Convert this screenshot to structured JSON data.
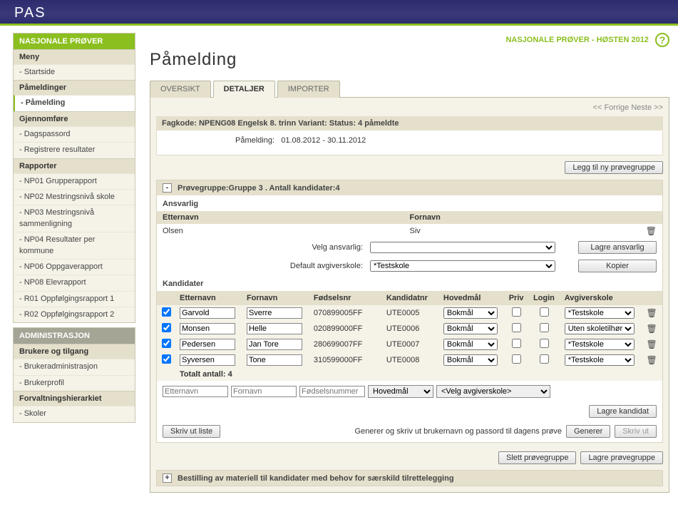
{
  "app": {
    "title": "PAS"
  },
  "context": {
    "label": "NASJONALE PRØVER - HØSTEN 2012",
    "help": "?"
  },
  "page": {
    "title": "Påmelding"
  },
  "sidebar": {
    "sections": [
      {
        "header": "NASJONALE PRØVER",
        "groups": [
          {
            "title": "Meny",
            "items": [
              "- Startside"
            ]
          },
          {
            "title": "Påmeldinger",
            "items": [
              "- Påmelding"
            ],
            "activeItem": "- Påmelding"
          },
          {
            "title": "Gjennomføre",
            "items": [
              "- Dagspassord",
              "- Registrere resultater"
            ]
          },
          {
            "title": "Rapporter",
            "items": [
              "- NP01 Grupperapport",
              "- NP02 Mestringsnivå skole",
              "- NP03 Mestringsnivå sammenligning",
              "- NP04 Resultater per kommune",
              "- NP06 Oppgaverapport",
              "- NP08 Elevrapport",
              "- R01 Oppfølgingsrapport 1",
              "- R02 Oppfølgingsrapport 2"
            ]
          }
        ]
      },
      {
        "header": "ADMINISTRASJON",
        "headerClass": "grey",
        "groups": [
          {
            "title": "Brukere og tilgang",
            "items": [
              "- Brukeradministrasjon",
              "- Brukerprofil"
            ]
          },
          {
            "title": "Forvaltningshierarkiet",
            "items": [
              "- Skoler"
            ]
          }
        ]
      }
    ]
  },
  "tabs": [
    {
      "label": "OVERSIKT",
      "active": false
    },
    {
      "label": "DETALJER",
      "active": true
    },
    {
      "label": "IMPORTER",
      "active": false
    }
  ],
  "pager": {
    "prev": "<< Forrige",
    "next": "Neste >>"
  },
  "infobar": "Fagkode: NPENG08 Engelsk 8. trinn Variant: Status: 4 påmeldte",
  "infobody": {
    "label": "Påmelding:",
    "value": "01.08.2012 - 30.11.2012"
  },
  "buttons": {
    "addGroup": "Legg til ny prøvegruppe",
    "saveResp": "Lagre ansvarlig",
    "copy": "Kopier",
    "saveCand": "Lagre kandidat",
    "printList": "Skriv ut liste",
    "generate": "Generer",
    "print": "Skriv ut",
    "deleteGroup": "Slett prøvegruppe",
    "saveGroup": "Lagre prøvegruppe"
  },
  "group": {
    "toggle": "-",
    "title": "Prøvegruppe:Gruppe 3 . Antall kandidater:4",
    "ansvarlig": "Ansvarlig",
    "headers": {
      "lastname": "Etternavn",
      "firstname": "Fornavn"
    },
    "resp": {
      "lastname": "Olsen",
      "firstname": "Siv"
    },
    "selectResp": "Velg ansvarlig:",
    "defaultSchool": "Default avgiverskole:",
    "schoolValue": "*Testskole",
    "kandidater": "Kandidater",
    "cols": {
      "lastname": "Etternavn",
      "firstname": "Fornavn",
      "dob": "Fødselsnr",
      "candno": "Kandidatnr",
      "lang": "Hovedmål",
      "priv": "Priv",
      "login": "Login",
      "school": "Avgiverskole"
    },
    "rows": [
      {
        "checked": true,
        "lastname": "Garvold",
        "firstname": "Sverre",
        "dob": "070899005FF",
        "candno": "UTE0005",
        "lang": "Bokmål",
        "school": "*Testskole"
      },
      {
        "checked": true,
        "lastname": "Monsen",
        "firstname": "Helle",
        "dob": "020899000FF",
        "candno": "UTE0006",
        "lang": "Bokmål",
        "school": "Uten skoletilhørighet"
      },
      {
        "checked": true,
        "lastname": "Pedersen",
        "firstname": "Jan Tore",
        "dob": "280699007FF",
        "candno": "UTE0007",
        "lang": "Bokmål",
        "school": "*Testskole"
      },
      {
        "checked": true,
        "lastname": "Syversen",
        "firstname": "Tone",
        "dob": "310599000FF",
        "candno": "UTE0008",
        "lang": "Bokmål",
        "school": "*Testskole"
      }
    ],
    "total": "Totalt antall: 4",
    "add": {
      "lastname": "Etternavn",
      "firstname": "Fornavn",
      "dob": "Fødselsnummer",
      "lang": "Hovedmål",
      "school": "<Velg avgiverskole>"
    },
    "genText": "Generer og skriv ut brukernavn og passord til dagens prøve"
  },
  "collapsed": {
    "toggle": "+",
    "title": "Bestilling av materiell til kandidater med behov for særskild tilrettelegging"
  }
}
